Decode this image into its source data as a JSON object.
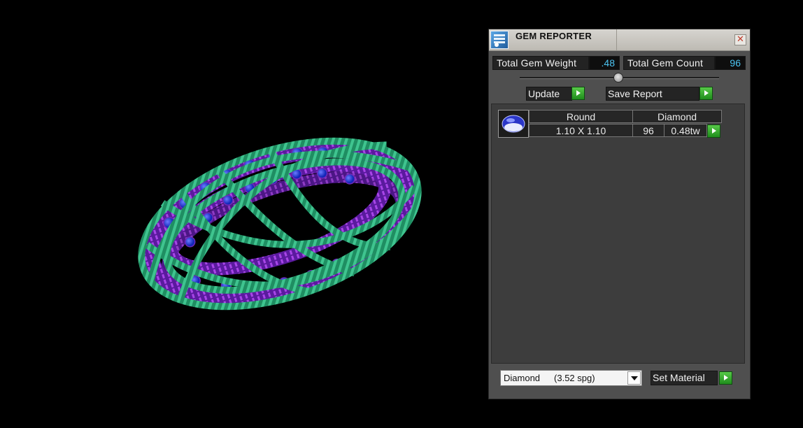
{
  "panel": {
    "title": "GEM REPORTER",
    "close_glyph": "✕",
    "total_gem_weight_label": "Total Gem Weight",
    "total_gem_weight_value": ".48",
    "total_gem_count_label": "Total Gem Count",
    "total_gem_count_value": "96",
    "update_label": "Update",
    "save_report_label": "Save Report",
    "gem_list": [
      {
        "shape": "Round",
        "material": "Diamond",
        "size": "1.10 X 1.10",
        "count": "96",
        "weight": "0.48tw"
      }
    ],
    "material_select": {
      "name": "Diamond",
      "density": "(3.52 spg)"
    },
    "set_material_label": "Set Material"
  },
  "icons": {
    "app": "gem-reporter-app-icon",
    "close": "close-icon",
    "go": "play-arrow-icon",
    "dropdown": "chevron-down-icon",
    "gem": "round-gem-icon"
  },
  "colors": {
    "viewport_bg": "#000000",
    "panel_bg": "#4f4f4f",
    "value_text": "#4cc4f2",
    "go_button": "#2fa52a"
  }
}
